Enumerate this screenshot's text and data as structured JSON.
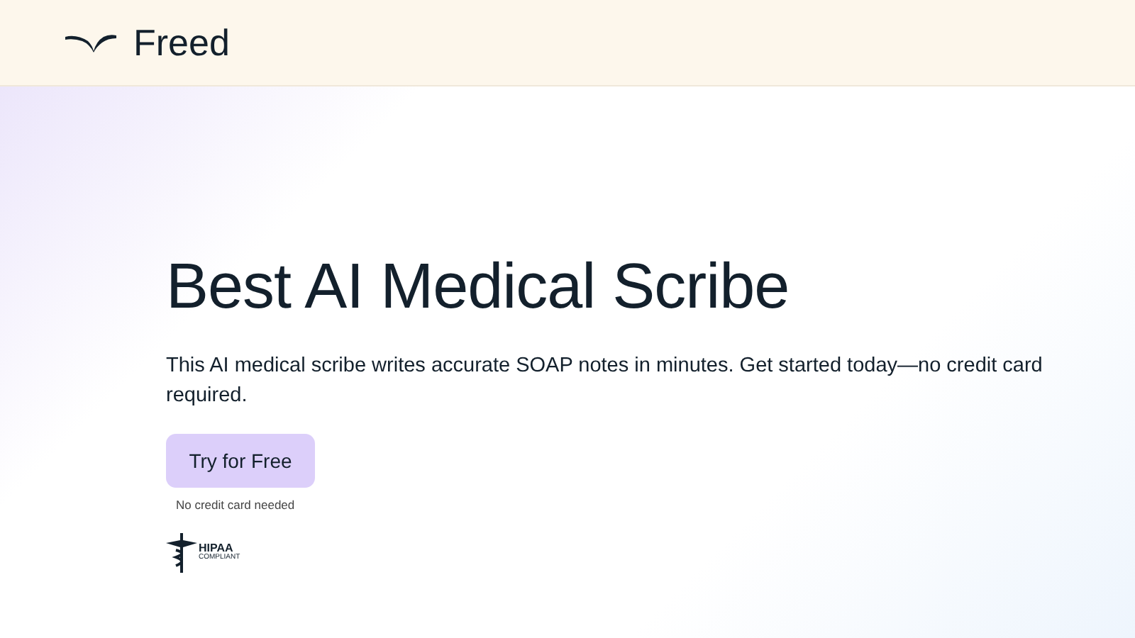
{
  "header": {
    "logo_text": "Freed"
  },
  "hero": {
    "title": "Best AI Medical Scribe",
    "description": "This AI medical scribe writes accurate SOAP notes in minutes. Get started today—no credit card required.",
    "cta": "Try for Free",
    "cta_note": "No credit card needed",
    "badge": {
      "title": "HIPAA",
      "subtitle": "COMPLIANT"
    }
  }
}
